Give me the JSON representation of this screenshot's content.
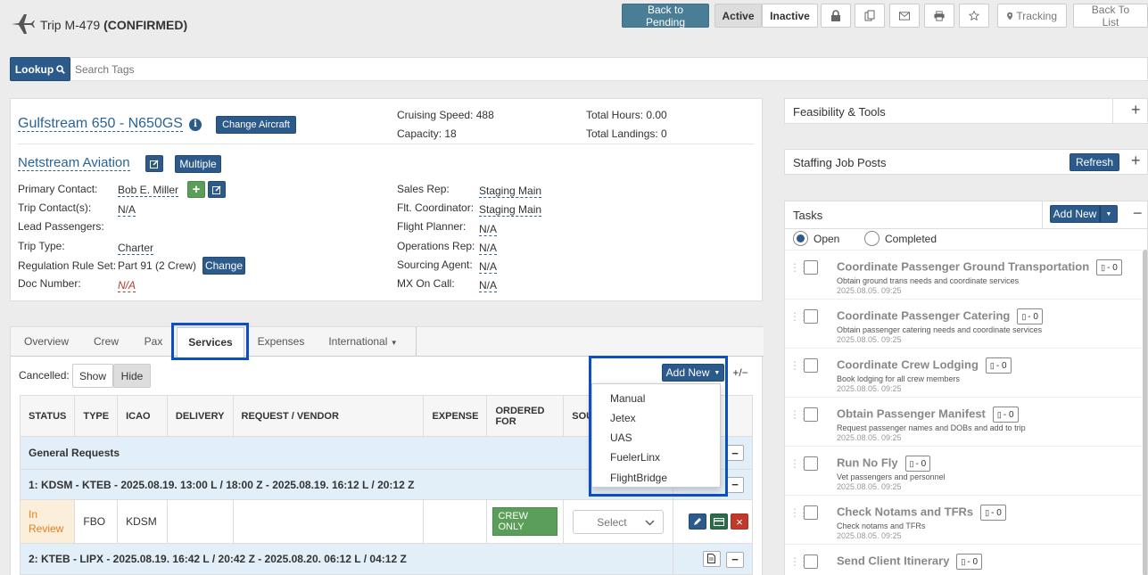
{
  "header": {
    "trip_label": "Trip M-479",
    "trip_status": "(CONFIRMED)"
  },
  "topbar": {
    "back_to_pending": "Back to Pending",
    "active": "Active",
    "inactive": "Inactive",
    "tracking": "Tracking",
    "back_to_list": "Back To List"
  },
  "search": {
    "lookup_label": "Lookup",
    "placeholder": "Search Tags"
  },
  "aircraft": {
    "name": "Gulfstream 650 - N650GS",
    "change_aircraft": "Change Aircraft",
    "cruising_speed": "Cruising Speed: 488",
    "capacity": "Capacity: 18",
    "total_hours": "Total Hours: 0.00",
    "total_landings": "Total Landings: 0"
  },
  "operator": {
    "name": "Netstream Aviation",
    "multiple": "Multiple"
  },
  "fields_left": [
    {
      "label": "Primary Contact:",
      "value": "Bob E. Miller"
    },
    {
      "label": "Trip Contact(s):",
      "value": "N/A"
    },
    {
      "label": "Lead Passengers:",
      "value": ""
    },
    {
      "label": "Trip Type:",
      "value": "Charter"
    },
    {
      "label": "Regulation Rule Set:",
      "value": "Part 91 (2 Crew)"
    },
    {
      "label": "Doc Number:",
      "value": "N/A"
    }
  ],
  "change_label": "Change",
  "fields_right": [
    {
      "label": "Sales Rep:",
      "value": "Staging Main"
    },
    {
      "label": "Flt. Coordinator:",
      "value": "Staging Main"
    },
    {
      "label": "Flight Planner:",
      "value": "N/A"
    },
    {
      "label": "Operations Rep:",
      "value": "N/A"
    },
    {
      "label": "Sourcing Agent:",
      "value": "N/A"
    },
    {
      "label": "MX On Call:",
      "value": "N/A"
    }
  ],
  "tabs": [
    "Overview",
    "Crew",
    "Pax",
    "Services",
    "Expenses",
    "International"
  ],
  "services": {
    "cancelled_label": "Cancelled:",
    "show": "Show",
    "hide": "Hide",
    "add_new": "Add New",
    "plus_minus": "+/−",
    "columns": [
      "STATUS",
      "TYPE",
      "ICAO",
      "DELIVERY",
      "REQUEST / VENDOR",
      "EXPENSE",
      "ORDERED FOR",
      "SOU"
    ],
    "general_requests": "General Requests",
    "leg1": "1: KDSM - KTEB - 2025.08.19. 13:00 L / 18:00 Z - 2025.08.19. 16:12 L / 20:12 Z",
    "row": {
      "status": "In Review",
      "type": "FBO",
      "icao": "KDSM",
      "ordered_for": "CREW ONLY",
      "select": "Select"
    },
    "leg2": "2: KTEB - LIPX - 2025.08.19. 16:42 L / 20:42 Z - 2025.08.20. 06:12 L / 04:12 Z"
  },
  "add_new_menu": [
    "Manual",
    "Jetex",
    "UAS",
    "FuelerLinx",
    "FlightBridge"
  ],
  "sidebar": {
    "feasibility": "Feasibility & Tools",
    "staffing": "Staffing Job Posts",
    "refresh": "Refresh",
    "tasks": "Tasks",
    "add_new": "Add New",
    "open": "Open",
    "completed": "Completed"
  },
  "tasks": [
    {
      "title": "Coordinate Passenger Ground Transportation",
      "desc": "Obtain ground trans needs and coordinate services",
      "date": "2025.08.05. 09:25",
      "docs": "- 0"
    },
    {
      "title": "Coordinate Passenger Catering",
      "desc": "Obtain passenger catering needs and coordinate services",
      "date": "2025.08.05. 09:25",
      "docs": "- 0"
    },
    {
      "title": "Coordinate Crew Lodging",
      "desc": "Book lodging for all crew members",
      "date": "2025.08.05. 09:25",
      "docs": "- 0"
    },
    {
      "title": "Obtain Passenger Manifest",
      "desc": "Request passenger names and DOBs and add to trip",
      "date": "2025.08.05. 09:25",
      "docs": "- 0"
    },
    {
      "title": "Run No Fly",
      "desc": "Vet passengers and personnel",
      "date": "2025.08.05. 09:25",
      "docs": "- 0"
    },
    {
      "title": "Check Notams and TFRs",
      "desc": "Check notams and TFRs",
      "date": "2025.08.05. 09:25",
      "docs": "- 0"
    },
    {
      "title": "Send Client Itinerary",
      "desc": "",
      "date": "",
      "docs": "- 0"
    }
  ]
}
